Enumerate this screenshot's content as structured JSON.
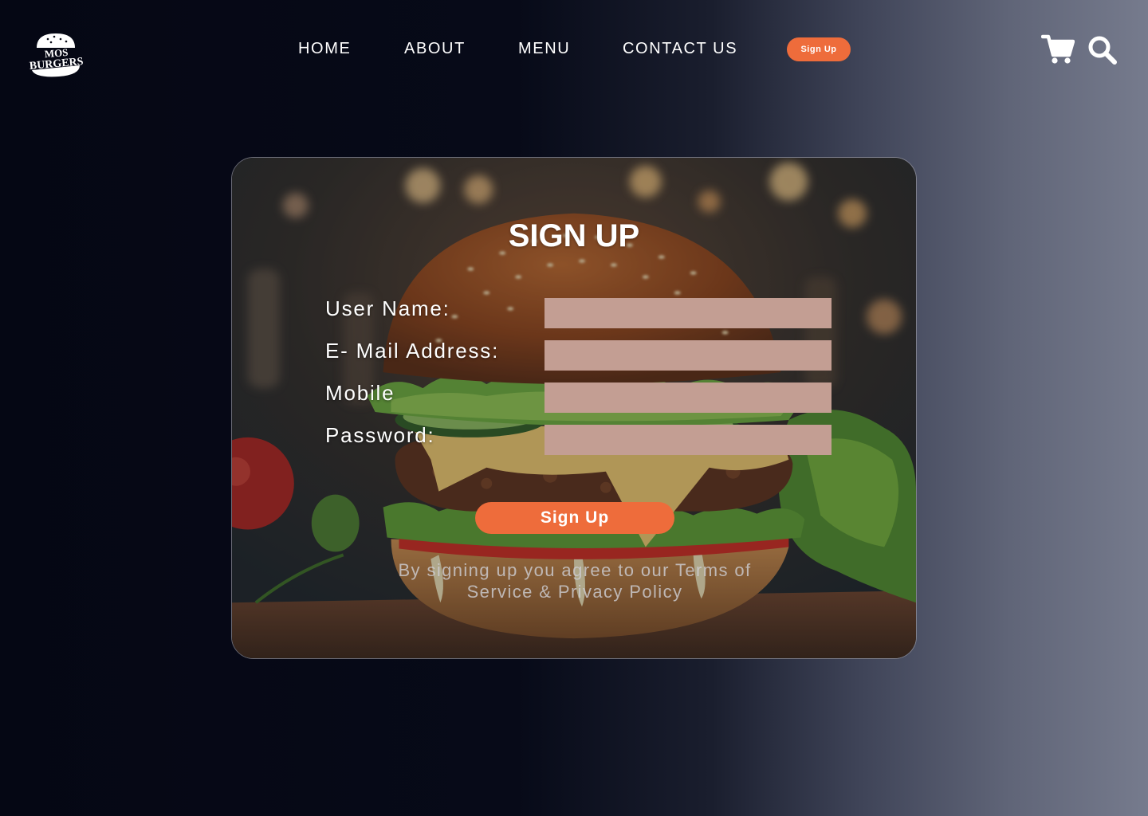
{
  "brand": {
    "logo_line1": "MOS",
    "logo_line2": "BURGERS"
  },
  "nav": {
    "items": [
      {
        "label": "HOME"
      },
      {
        "label": "ABOUT"
      },
      {
        "label": "MENU"
      },
      {
        "label": "CONTACT US"
      }
    ],
    "signup_label": "Sign Up"
  },
  "icons": {
    "cart": "cart-icon",
    "search": "search-icon"
  },
  "form": {
    "title": "SIGN UP",
    "fields": [
      {
        "label": "User Name:",
        "value": ""
      },
      {
        "label": "E- Mail Address:",
        "value": ""
      },
      {
        "label": "Mobile",
        "value": ""
      },
      {
        "label": "Password:",
        "value": ""
      }
    ],
    "submit_label": "Sign Up",
    "terms_line1": "By signing up you agree to our Terms of",
    "terms_line2": "Service & Privacy Policy"
  },
  "colors": {
    "accent": "#ee6c3b",
    "input_bg": "#c39e93",
    "background_dark": "#050714",
    "background_light": "#767b8d"
  }
}
